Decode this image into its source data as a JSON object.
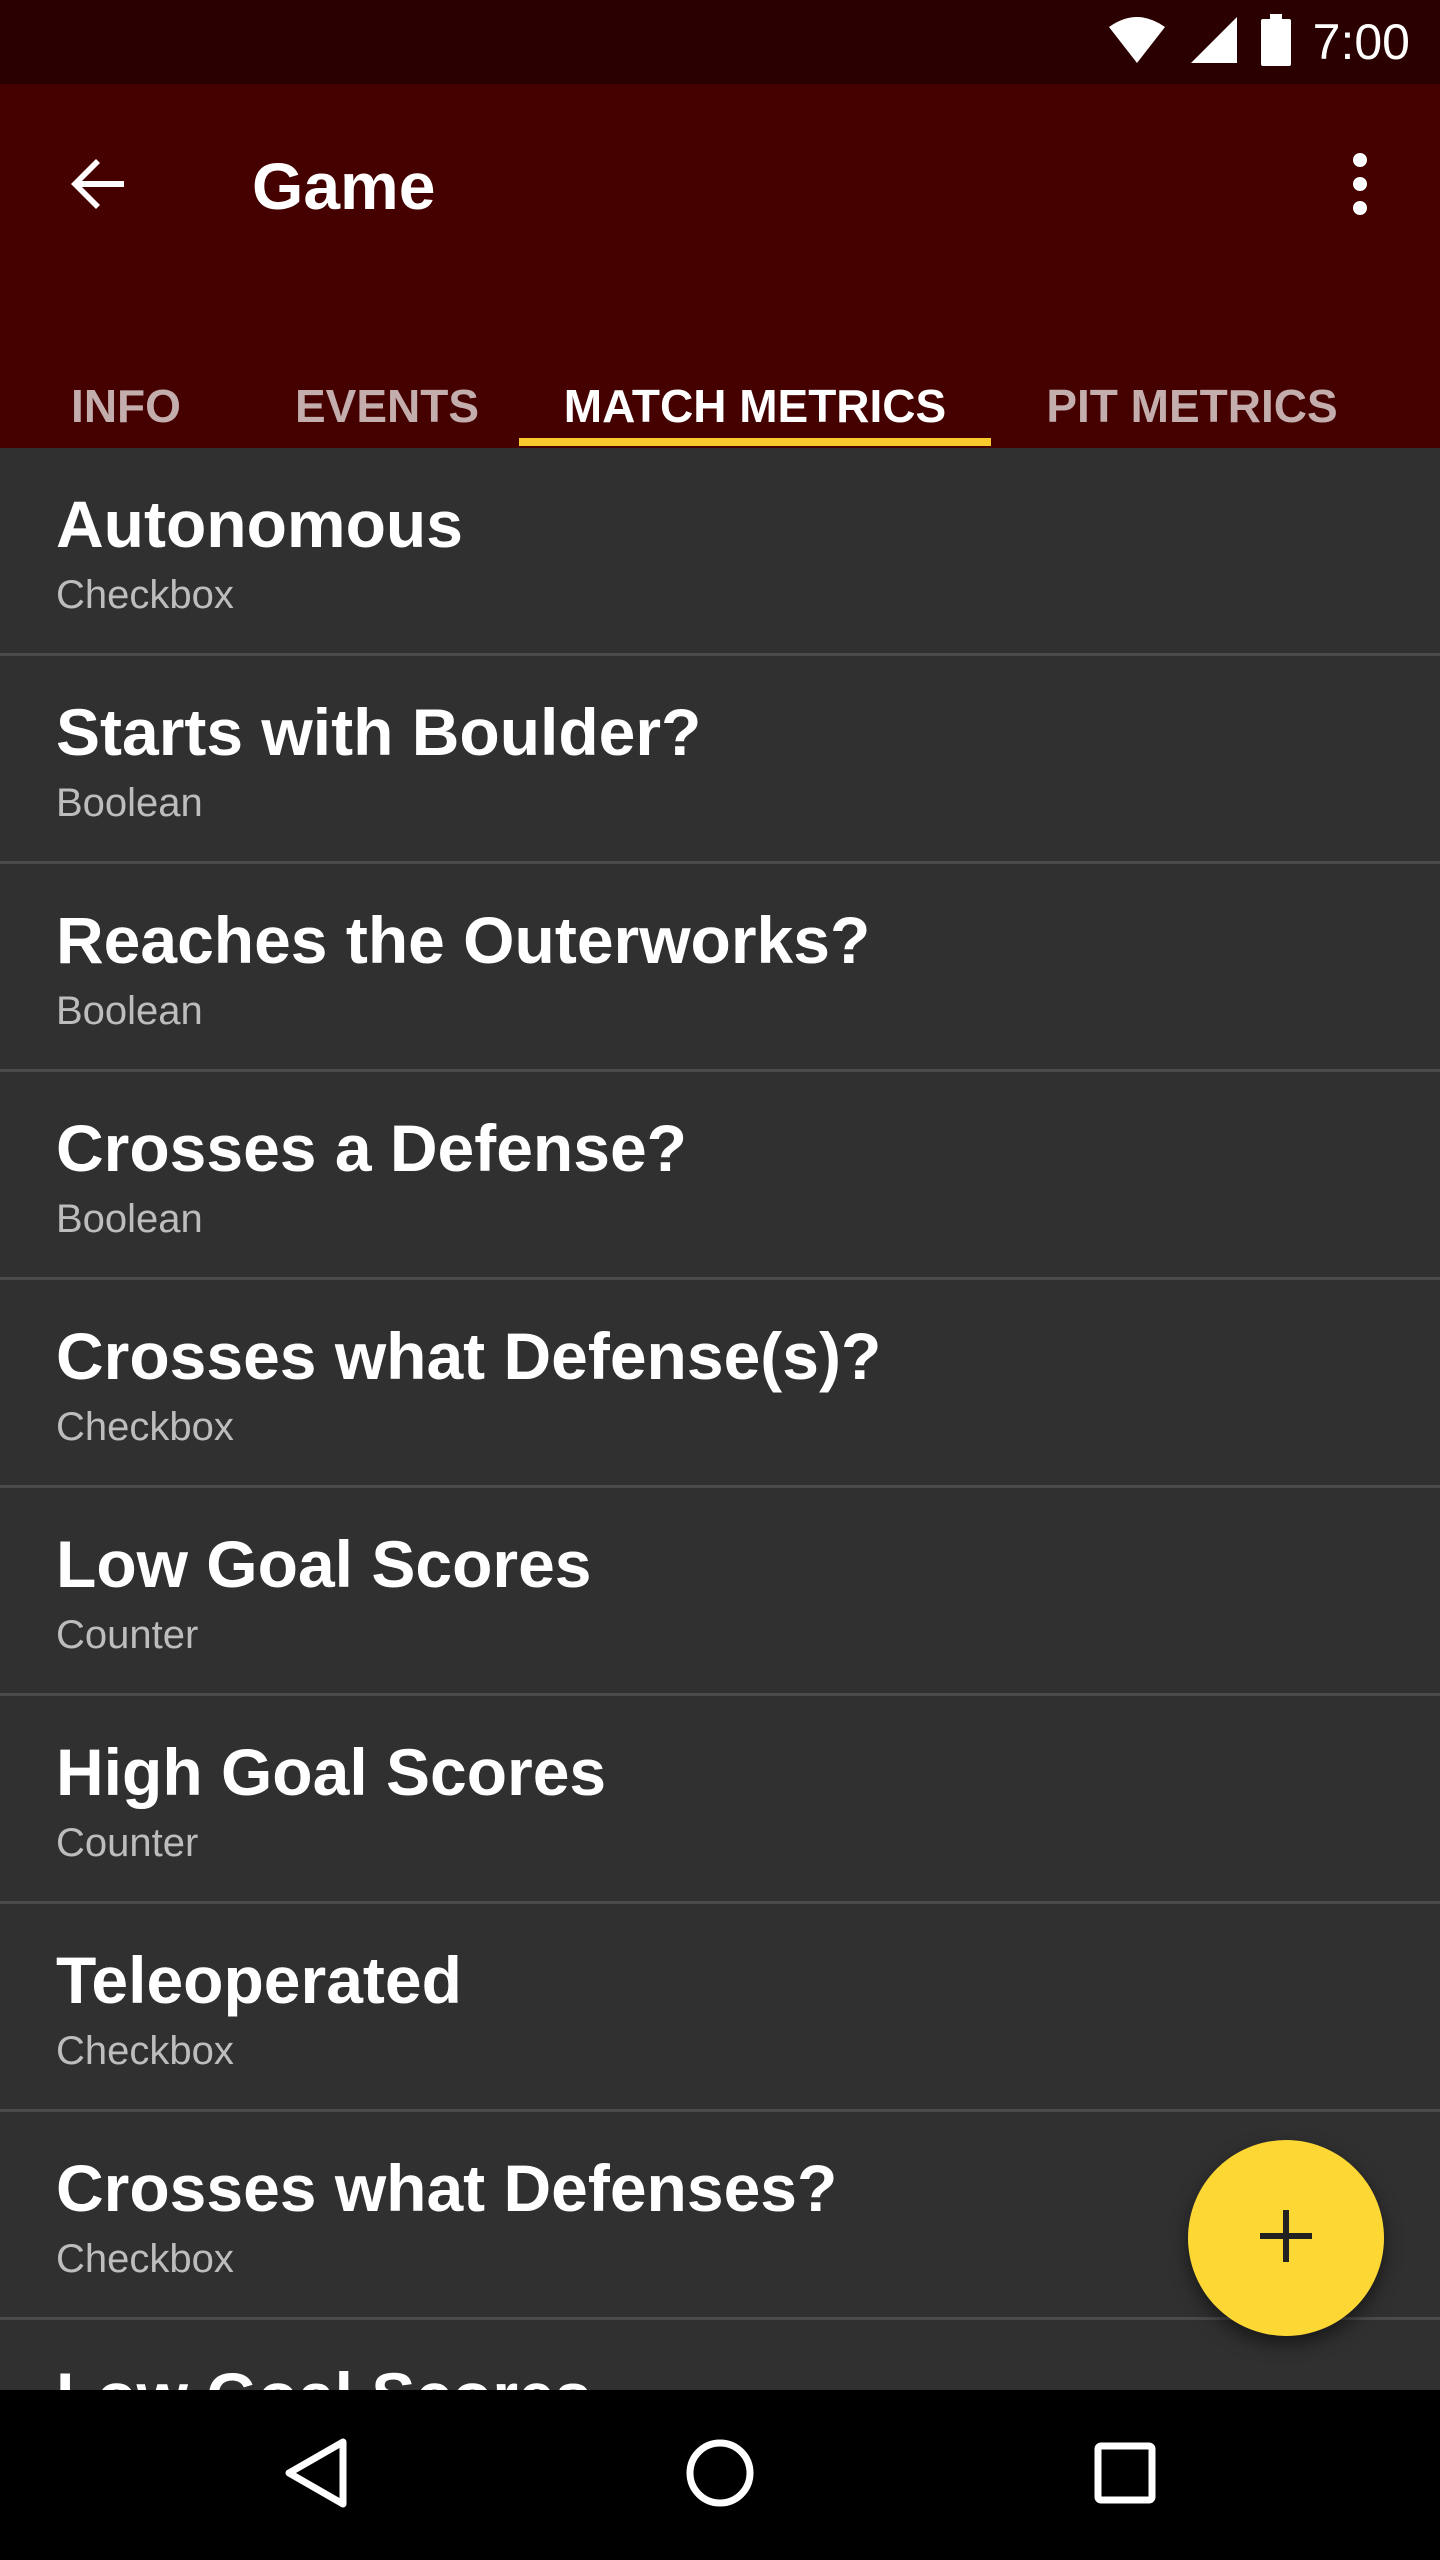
{
  "status_bar": {
    "time": "7:00",
    "icons": [
      "wifi-icon",
      "cell-signal-icon",
      "battery-icon"
    ]
  },
  "app_bar": {
    "title": "Game",
    "back_icon": "arrow-back-icon",
    "menu_icon": "more-vert-icon"
  },
  "tabs": [
    {
      "label": "INFO",
      "active": false
    },
    {
      "label": "EVENTS",
      "active": false
    },
    {
      "label": "MATCH METRICS",
      "active": true
    },
    {
      "label": "PIT METRICS",
      "active": false
    }
  ],
  "metrics": [
    {
      "name": "Autonomous",
      "type": "Checkbox"
    },
    {
      "name": "Starts with Boulder?",
      "type": "Boolean"
    },
    {
      "name": "Reaches the Outerworks?",
      "type": "Boolean"
    },
    {
      "name": "Crosses a Defense?",
      "type": "Boolean"
    },
    {
      "name": "Crosses what Defense(s)?",
      "type": "Checkbox"
    },
    {
      "name": "Low Goal Scores",
      "type": "Counter"
    },
    {
      "name": "High Goal Scores",
      "type": "Counter"
    },
    {
      "name": "Teleoperated",
      "type": "Checkbox"
    },
    {
      "name": "Crosses what Defenses?",
      "type": "Checkbox"
    },
    {
      "name": "Low Goal Scores",
      "type": ""
    }
  ],
  "fab": {
    "icon": "add-icon"
  },
  "nav_bar": {
    "icons": [
      "nav-back-icon",
      "nav-home-icon",
      "nav-recents-icon"
    ]
  },
  "colors": {
    "status_bar": "#2a0000",
    "app_bar": "#450000",
    "accent": "#f9c92d",
    "fab": "#fdd835",
    "list_background": "#303030",
    "divider": "#4a4a4a"
  }
}
